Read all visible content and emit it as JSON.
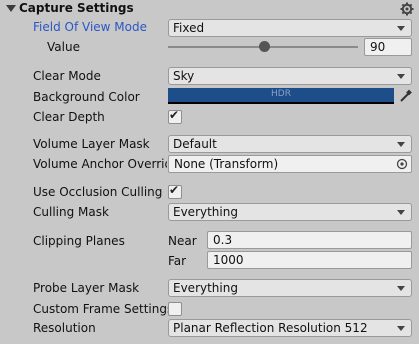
{
  "header": {
    "title": "Capture Settings",
    "icon": "gear-icon"
  },
  "fov_mode": {
    "label": "Field Of View Mode",
    "value": "Fixed",
    "label_color": "#2a56c6"
  },
  "value_row": {
    "label": "Value",
    "slider_fraction": 0.5,
    "value": "90"
  },
  "clear_mode": {
    "label": "Clear Mode",
    "value": "Sky"
  },
  "background_color": {
    "label": "Background Color",
    "swatch_text": "HDR",
    "color": "#1d4e89"
  },
  "clear_depth": {
    "label": "Clear Depth",
    "checked": true
  },
  "volume_layer_mask": {
    "label": "Volume Layer Mask",
    "value": "Default"
  },
  "volume_anchor": {
    "label": "Volume Anchor Override",
    "value": "None (Transform)"
  },
  "occlusion": {
    "label": "Use Occlusion Culling",
    "checked": true
  },
  "culling_mask": {
    "label": "Culling Mask",
    "value": "Everything"
  },
  "clipping": {
    "label": "Clipping Planes",
    "near_label": "Near",
    "near_value": "0.3",
    "far_label": "Far",
    "far_value": "1000"
  },
  "probe_layer_mask": {
    "label": "Probe Layer Mask",
    "value": "Everything"
  },
  "custom_frame": {
    "label": "Custom Frame Settings",
    "checked": false
  },
  "resolution": {
    "label": "Resolution",
    "value": "Planar Reflection Resolution 512"
  }
}
